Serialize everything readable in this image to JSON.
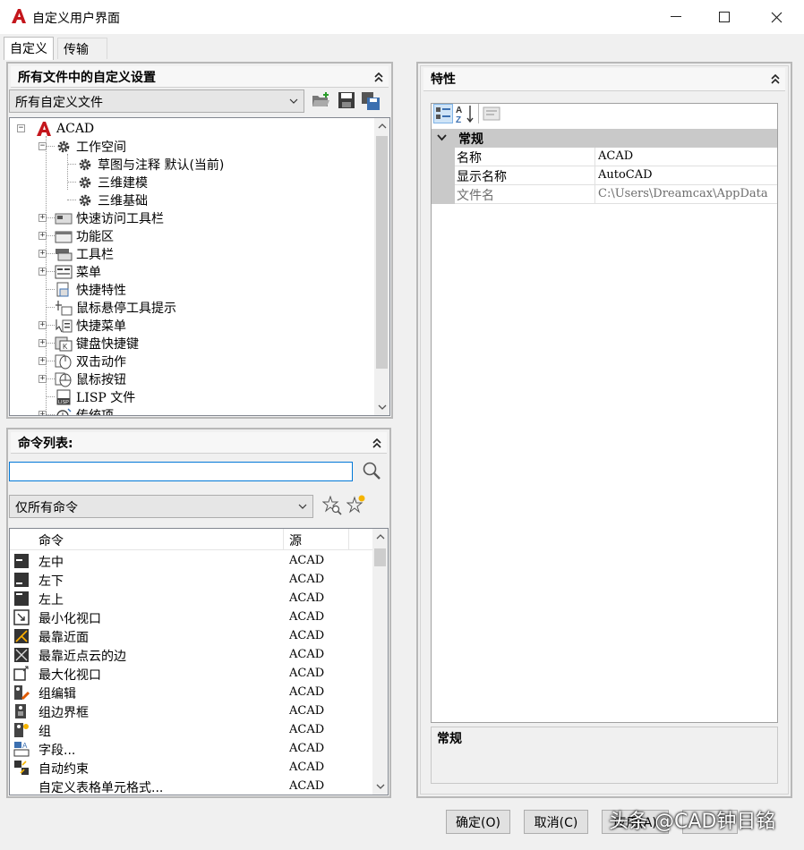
{
  "window": {
    "title": "自定义用户界面",
    "minimize_glyph": "—",
    "maximize_glyph": "☐",
    "close_glyph": "✕"
  },
  "tabs": [
    {
      "label": "自定义",
      "active": true
    },
    {
      "label": "传输",
      "active": false
    }
  ],
  "customize_panel": {
    "header": "所有文件中的自定义设置",
    "file_combo": "所有自定义文件",
    "tree": [
      {
        "label": "ACAD",
        "icon": "autocad-logo-icon",
        "expander": "−"
      },
      {
        "label": "工作空间",
        "icon": "gear-icon",
        "expander": "−"
      },
      {
        "label": "草图与注释 默认(当前)",
        "icon": "gear-icon",
        "expander": ""
      },
      {
        "label": "三维建模",
        "icon": "gear-icon",
        "expander": ""
      },
      {
        "label": "三维基础",
        "icon": "gear-icon",
        "expander": ""
      },
      {
        "label": "快速访问工具栏",
        "icon": "quick-access-toolbar-icon",
        "expander": "+"
      },
      {
        "label": "功能区",
        "icon": "ribbon-icon",
        "expander": "+"
      },
      {
        "label": "工具栏",
        "icon": "toolbar-icon",
        "expander": "+"
      },
      {
        "label": "菜单",
        "icon": "menu-icon",
        "expander": "+"
      },
      {
        "label": "快捷特性",
        "icon": "quick-properties-icon",
        "expander": ""
      },
      {
        "label": "鼠标悬停工具提示",
        "icon": "rollover-tooltip-icon",
        "expander": ""
      },
      {
        "label": "快捷菜单",
        "icon": "shortcut-menu-icon",
        "expander": "+"
      },
      {
        "label": "键盘快捷键",
        "icon": "keyboard-shortcut-icon",
        "expander": "+"
      },
      {
        "label": "双击动作",
        "icon": "double-click-icon",
        "expander": "+"
      },
      {
        "label": "鼠标按钮",
        "icon": "mouse-icon",
        "expander": "+"
      },
      {
        "label": "LISP 文件",
        "icon": "lisp-file-icon",
        "expander": ""
      },
      {
        "label": "传统项",
        "icon": "legacy-icon",
        "expander": "+"
      }
    ]
  },
  "command_panel": {
    "header": "命令列表:",
    "search_value": "",
    "filter_combo": "仅所有命令",
    "columns": {
      "command": "命令",
      "source": "源"
    },
    "rows": [
      {
        "command": "左中",
        "source": "ACAD"
      },
      {
        "command": "左下",
        "source": "ACAD"
      },
      {
        "command": "左上",
        "source": "ACAD"
      },
      {
        "command": "最小化视口",
        "source": "ACAD"
      },
      {
        "command": "最靠近面",
        "source": "ACAD"
      },
      {
        "command": "最靠近点云的边",
        "source": "ACAD"
      },
      {
        "command": "最大化视口",
        "source": "ACAD"
      },
      {
        "command": "组编辑",
        "source": "ACAD"
      },
      {
        "command": "组边界框",
        "source": "ACAD"
      },
      {
        "command": "组",
        "source": "ACAD"
      },
      {
        "command": "字段...",
        "source": "ACAD"
      },
      {
        "command": "自动约束",
        "source": "ACAD"
      },
      {
        "command": "自定义表格单元格式...",
        "source": "ACAD"
      }
    ]
  },
  "properties_panel": {
    "header": "特性",
    "category": "常规",
    "rows": [
      {
        "name": "名称",
        "value": "ACAD",
        "disabled": false
      },
      {
        "name": "显示名称",
        "value": "AutoCAD",
        "disabled": false
      },
      {
        "name": "文件名",
        "value": "C:\\Users\\Dreamcax\\AppData",
        "disabled": true
      }
    ],
    "description_title": "常规"
  },
  "buttons": {
    "ok": "确定(O)",
    "cancel": "取消(C)",
    "apply": "应用(A)"
  },
  "watermark": "头条 @CAD钟日铭",
  "colors": {
    "accent_red": "#c4161c",
    "focus_blue": "#0078d7",
    "category_gray": "#c9c9c9"
  }
}
